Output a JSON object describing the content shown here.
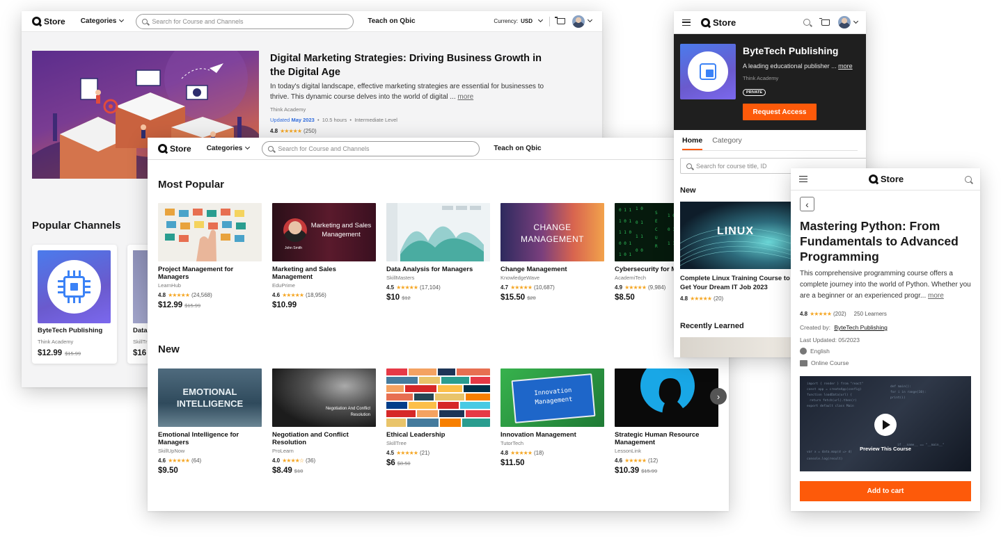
{
  "store_header": {
    "logo": "Store",
    "categories": "Categories",
    "search_placeholder": "Search for Course and Channels",
    "teach": "Teach on Qbic",
    "currency_label": "Currency:",
    "currency_value": "USD"
  },
  "featured": {
    "title": "Digital Marketing Strategies: Driving Business Growth in the Digital Age",
    "description": "In today's digital landscape, effective marketing strategies are essential for businesses to thrive. This dynamic course delves into the world of digital ...",
    "more": "more",
    "author": "Think Academy",
    "updated_label": "Updated",
    "updated_value": "May 2023",
    "hours": "10.5 hours",
    "level": "Intermediate Level",
    "rating": "4.8",
    "stars": "★★★★★",
    "reviews": "(250)"
  },
  "popular_channels": {
    "heading": "Popular Channels",
    "cards": [
      {
        "name": "ByteTech Publishing",
        "provider": "Think Academy",
        "price": "$12.99",
        "old_price": "$15.99"
      },
      {
        "name": "Data",
        "provider": "SkillTr",
        "price": "$16",
        "old_price": ""
      }
    ]
  },
  "most_popular": {
    "heading": "Most Popular",
    "courses": [
      {
        "title": "Project Management for Managers",
        "provider": "LearnHub",
        "rating": "4.8",
        "stars": "★★★★★",
        "reviews": "(24,568)",
        "price": "$12.99",
        "old_price": "$15.99"
      },
      {
        "title": "Marketing and Sales Management",
        "provider": "EduPrime",
        "rating": "4.6",
        "stars": "★★★★★",
        "reviews": "(18,956)",
        "price": "$10.99",
        "old_price": "",
        "thumb_text": "Marketing and Sales Management",
        "thumb_sub": "John Smith"
      },
      {
        "title": "Data Analysis for Managers",
        "provider": "SkillMasters",
        "rating": "4.5",
        "stars": "★★★★★",
        "reviews": "(17,104)",
        "price": "$10",
        "old_price": "$12"
      },
      {
        "title": "Change Management",
        "provider": "KnowledgeWave",
        "rating": "4.7",
        "stars": "★★★★★",
        "reviews": "(10,687)",
        "price": "$15.50",
        "old_price": "$20",
        "thumb_text": "CHANGE MANAGEMENT"
      },
      {
        "title": "Cybersecurity for M",
        "provider": "AcademiTech",
        "rating": "4.9",
        "stars": "★★★★★",
        "reviews": "(9,984)",
        "price": "$8.50",
        "old_price": ""
      }
    ]
  },
  "new_section": {
    "heading": "New",
    "courses": [
      {
        "title": "Emotional Intelligence for Managers",
        "provider": "SkillUpNow",
        "rating": "4.6",
        "stars": "★★★★★",
        "reviews": "(64)",
        "price": "$9.50",
        "old_price": "",
        "thumb_text": "EMOTIONAL INTELLIGENCE"
      },
      {
        "title": "Negotiation and Conflict Resolution",
        "provider": "ProLearn",
        "rating": "4.0",
        "stars": "★★★★☆",
        "reviews": "(36)",
        "price": "$8.49",
        "old_price": "$10",
        "thumb_text": "Negotiation And Conflict Resolution"
      },
      {
        "title": "Ethical Leadership",
        "provider": "SkillTree",
        "rating": "4.5",
        "stars": "★★★★★",
        "reviews": "(21)",
        "price": "$6",
        "old_price": "$8.50"
      },
      {
        "title": "Innovation Management",
        "provider": "TutorTech",
        "rating": "4.8",
        "stars": "★★★★★",
        "reviews": "(18)",
        "price": "$11.50",
        "old_price": "",
        "thumb_text": "Innovation Management"
      },
      {
        "title": "Strategic Human Resource Management",
        "provider": "LessonLink",
        "rating": "4.6",
        "stars": "★★★★★",
        "reviews": "(12)",
        "price": "$10.39",
        "old_price": "$15.99"
      }
    ],
    "next": "›"
  },
  "channel_page": {
    "logo": "Store",
    "name": "ByteTech Publishing",
    "description": "A leading educational publisher ...",
    "more": "more",
    "provider": "Think Academy",
    "badge": "PRIVATE",
    "request_button": "Request Access",
    "tabs": [
      "Home",
      "Category"
    ],
    "search_placeholder": "Search for course title, ID",
    "new_heading": "New",
    "new_course_title": "Complete Linux Training Course to Get Your Dream IT Job 2023",
    "new_course_thumb": "LINUX",
    "new_course_rating": "4.8",
    "new_course_stars": "★★★★★",
    "new_course_reviews": "(20)",
    "recently_heading": "Recently Learned"
  },
  "course_page": {
    "logo": "Store",
    "title": "Mastering Python: From Fundamentals to Advanced Programming",
    "description": "This comprehensive programming course offers a complete journey into the world of Python. Whether you are a beginner or an experienced progr...",
    "more": "more",
    "rating": "4.8",
    "stars": "★★★★★",
    "reviews": "(202)",
    "learners": "250 Learners",
    "created_label": "Created by:",
    "created_value": "ByteTech Publishing",
    "updated": "Last Updated: 05/2023",
    "language": "English",
    "format": "Online Course",
    "preview": "Preview This Course",
    "add_to_cart": "Add to cart",
    "back": "‹"
  },
  "colors": {
    "accent": "#fd5a0a",
    "link_blue": "#2f6bdc",
    "star": "#f5a623",
    "dark_banner": "#1f1f1f"
  }
}
